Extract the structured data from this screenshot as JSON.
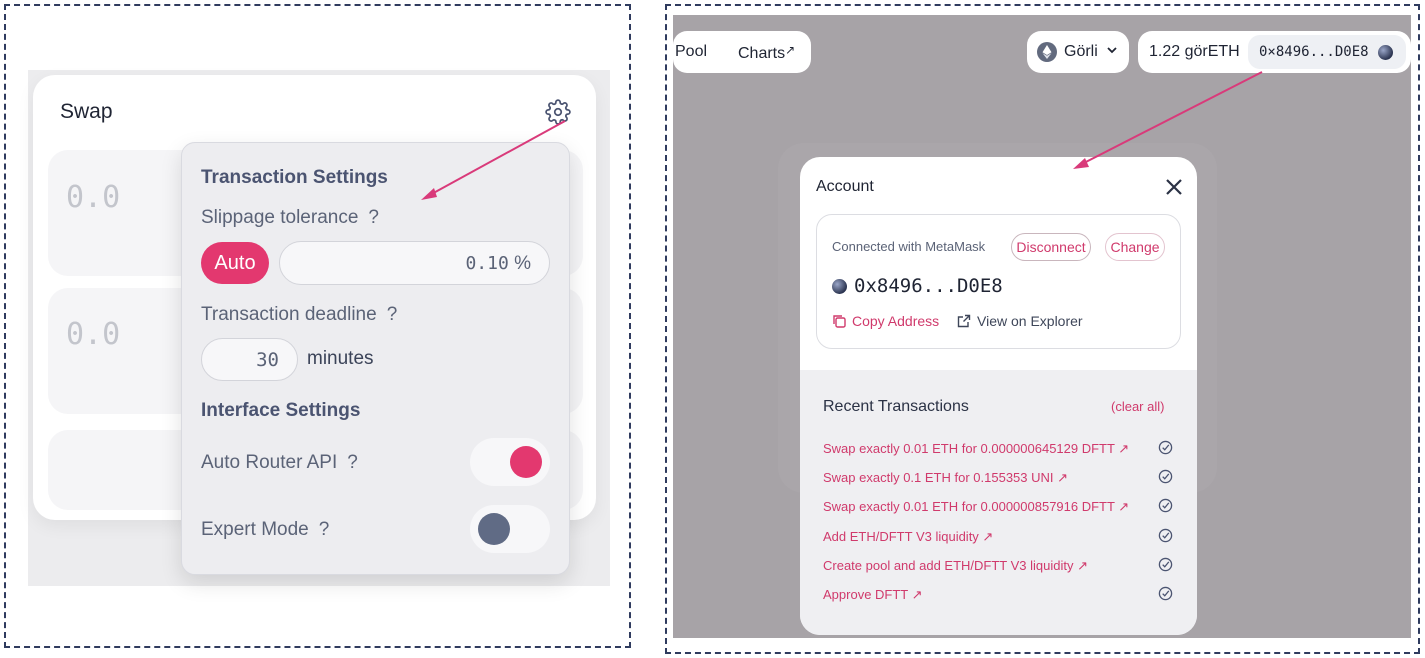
{
  "left": {
    "swap_title": "Swap",
    "amounts": [
      "0.0",
      "0.0"
    ],
    "settings": {
      "transaction_heading": "Transaction Settings",
      "slippage_label": "Slippage tolerance",
      "help": "?",
      "auto_label": "Auto",
      "slippage_value": "0.10",
      "percent": "%",
      "deadline_label": "Transaction deadline",
      "deadline_value": "30",
      "minutes": "minutes",
      "interface_heading": "Interface Settings",
      "auto_router_label": "Auto Router API",
      "auto_router_on": true,
      "expert_mode_label": "Expert Mode",
      "expert_mode_on": false
    },
    "accent": "#e3386f"
  },
  "right": {
    "nav": {
      "pool": "Pool",
      "charts": "Charts",
      "charts_arrow": "↗",
      "network": "Görli",
      "balance": "1.22 görETH",
      "address": "0×8496...D0E8"
    },
    "modal": {
      "title": "Account",
      "connected_with": "Connected with MetaMask",
      "disconnect": "Disconnect",
      "change": "Change",
      "address": "0x8496...D0E8",
      "copy_address": "Copy Address",
      "view_explorer": "View on Explorer",
      "recent_title": "Recent Transactions",
      "clear_all": "(clear all)",
      "transactions": [
        "Swap exactly 0.01 ETH for 0.000000645129 DFTT ↗",
        "Swap exactly 0.1 ETH for 0.155353 UNI ↗",
        "Swap exactly 0.01 ETH for 0.000000857916 DFTT ↗",
        "Add ETH/DFTT V3 liquidity ↗",
        "Create pool and add ETH/DFTT V3 liquidity ↗",
        "Approve DFTT ↗"
      ]
    },
    "link_color": "#d03a6c"
  }
}
